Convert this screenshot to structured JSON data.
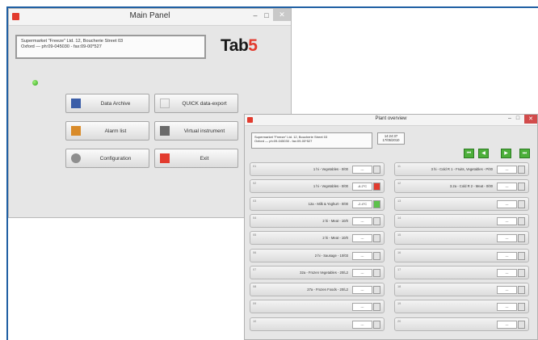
{
  "main": {
    "title": "Main Panel",
    "info_line1": "Supermarket \"Freeze\" Ltd. 12, Boucherie Street 03",
    "info_line2": "Oxford — ph:09-045030 - fax:09-00*527",
    "logo_main": "Tab",
    "logo_num": "5",
    "window_controls": {
      "minimize": "–",
      "maximize": "□",
      "close": "✕"
    },
    "buttons": [
      {
        "label": "Data Archive",
        "icon": "archive-icon",
        "color": "#3b5ea8"
      },
      {
        "label": "QUICK data-export",
        "icon": "export-icon",
        "color": "#e4e4e4"
      },
      {
        "label": "Alarm list",
        "icon": "alarm-list-icon",
        "color": "#d98b2a"
      },
      {
        "label": "Virtual instrument",
        "icon": "instrument-icon",
        "color": "#6b6b6b"
      },
      {
        "label": "Configuration",
        "icon": "gear-icon",
        "color": "#8e8e8e"
      },
      {
        "label": "Exit",
        "icon": "exit-icon",
        "color": "#e23b2e"
      }
    ]
  },
  "plant": {
    "title": "Plant overview",
    "info_line1": "Supermarket \"Freeze\" Ltd. 12, Boucherie Street 03",
    "info_line2": "Oxford — ph:09-045030 - fax:09-00*527",
    "time": "14:24:37",
    "date": "17/05/2010",
    "window_controls": {
      "minimize": "–",
      "maximize": "□",
      "close": "✕"
    },
    "nav": [
      "⏮",
      "◀",
      "▶",
      "⏭"
    ],
    "left_rows": [
      {
        "idx": "01",
        "name": "1 hi - Vegetables - 0/00",
        "value": "---",
        "status_color": "#e2e2e2"
      },
      {
        "idx": "02",
        "name": "1 hi - Vegetables - 0/00",
        "value": "-6.2°C",
        "status_color": "#e23b2e"
      },
      {
        "idx": "03",
        "name": "12a - Milk & Yoghurt - 0/00",
        "value": "-2.4°C",
        "status_color": "#5cc24a"
      },
      {
        "idx": "04",
        "name": "2 hi - Meat - 10/0",
        "value": "---",
        "status_color": "#e2e2e2"
      },
      {
        "idx": "05",
        "name": "2 hi - Meat - 10/0",
        "value": "---",
        "status_color": "#e2e2e2"
      },
      {
        "idx": "06",
        "name": "2 hi - Sausage - 10/03",
        "value": "---",
        "status_color": "#e2e2e2"
      },
      {
        "idx": "07",
        "name": "32a - Frozen Vegetables - 20/L2",
        "value": "---",
        "status_color": "#e2e2e2"
      },
      {
        "idx": "08",
        "name": "27a - Frozen Foods - 20/L2",
        "value": "---",
        "status_color": "#e2e2e2"
      },
      {
        "idx": "09",
        "name": "",
        "value": "---",
        "status_color": "#e2e2e2"
      },
      {
        "idx": "10",
        "name": "",
        "value": "---",
        "status_color": "#e2e2e2"
      }
    ],
    "right_rows": [
      {
        "idx": "11",
        "name": "3 hi - Cold R 1 - Fruits, Vegetables - P/00",
        "value": "---",
        "status_color": "#e2e2e2"
      },
      {
        "idx": "12",
        "name": "3.2a - Cold R 2 - Meat - 0/00",
        "value": "---",
        "status_color": "#e2e2e2"
      },
      {
        "idx": "13",
        "name": "",
        "value": "---",
        "status_color": "#e2e2e2"
      },
      {
        "idx": "14",
        "name": "",
        "value": "---",
        "status_color": "#e2e2e2"
      },
      {
        "idx": "15",
        "name": "",
        "value": "---",
        "status_color": "#e2e2e2"
      },
      {
        "idx": "16",
        "name": "",
        "value": "---",
        "status_color": "#e2e2e2"
      },
      {
        "idx": "17",
        "name": "",
        "value": "---",
        "status_color": "#e2e2e2"
      },
      {
        "idx": "18",
        "name": "",
        "value": "---",
        "status_color": "#e2e2e2"
      },
      {
        "idx": "19",
        "name": "",
        "value": "---",
        "status_color": "#e2e2e2"
      },
      {
        "idx": "20",
        "name": "",
        "value": "---",
        "status_color": "#e2e2e2"
      }
    ]
  }
}
